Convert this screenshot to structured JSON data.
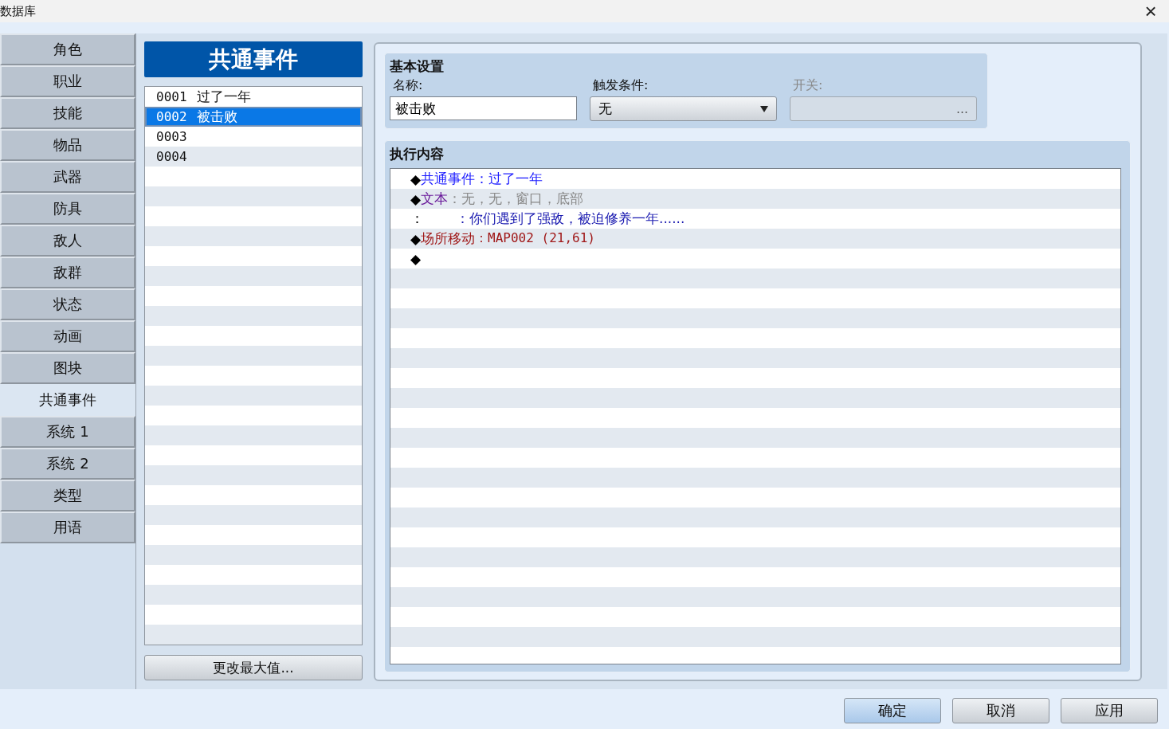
{
  "window": {
    "title": "数据库",
    "close": "×"
  },
  "sidebar": {
    "items": [
      {
        "label": "角色",
        "selected": false
      },
      {
        "label": "职业",
        "selected": false
      },
      {
        "label": "技能",
        "selected": false
      },
      {
        "label": "物品",
        "selected": false
      },
      {
        "label": "武器",
        "selected": false
      },
      {
        "label": "防具",
        "selected": false
      },
      {
        "label": "敌人",
        "selected": false
      },
      {
        "label": "敌群",
        "selected": false
      },
      {
        "label": "状态",
        "selected": false
      },
      {
        "label": "动画",
        "selected": false
      },
      {
        "label": "图块",
        "selected": false
      },
      {
        "label": "共通事件",
        "selected": true
      },
      {
        "label": "系统 1",
        "selected": false
      },
      {
        "label": "系统 2",
        "selected": false
      },
      {
        "label": "类型",
        "selected": false
      },
      {
        "label": "用语",
        "selected": false
      }
    ]
  },
  "event_list": {
    "title": "共通事件",
    "items": [
      {
        "id": "0001",
        "name": "过了一年",
        "selected": false
      },
      {
        "id": "0002",
        "name": "被击败",
        "selected": true
      },
      {
        "id": "0003",
        "selected": false
      },
      {
        "id": "0004",
        "selected": false
      }
    ],
    "change_max_button": "更改最大值..."
  },
  "basic_settings": {
    "title": "基本设置",
    "name": {
      "label": "名称:",
      "value": "被击败"
    },
    "trigger": {
      "label": "触发条件:",
      "value": "无"
    },
    "switch": {
      "label": "开关:",
      "button": "…",
      "disabled": true
    }
  },
  "contents": {
    "title": "执行内容",
    "lines": [
      {
        "parts": [
          {
            "text": "◆",
            "kind": "marker"
          },
          {
            "text": "共通事件：过了一年",
            "kind": "call"
          }
        ]
      },
      {
        "parts": [
          {
            "text": "◆",
            "kind": "marker"
          },
          {
            "text": "文本",
            "kind": "text"
          },
          {
            "text": "：无，无，窗口，底部",
            "kind": "param"
          }
        ]
      },
      {
        "parts": [
          {
            "text": "：",
            "kind": "marker"
          },
          {
            "text": "：你们遇到了强敌，被迫修养一年......",
            "kind": "message"
          }
        ]
      },
      {
        "parts": [
          {
            "text": "◆",
            "kind": "marker"
          },
          {
            "text": "场所移动",
            "kind": "move"
          },
          {
            "text": "：MAP002 (21,61)",
            "kind": "move-param"
          }
        ]
      },
      {
        "parts": [
          {
            "text": "◆",
            "kind": "marker"
          }
        ]
      }
    ]
  },
  "buttons": [
    {
      "label": "确定",
      "default": true
    },
    {
      "label": "取消",
      "default": false
    },
    {
      "label": "应用",
      "default": false
    }
  ]
}
